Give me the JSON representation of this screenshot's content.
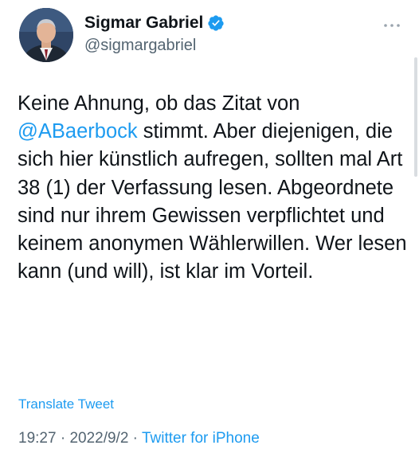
{
  "author": {
    "display_name": "Sigmar Gabriel",
    "handle": "@sigmargabriel",
    "verified": true,
    "avatar_icon": "profile-photo"
  },
  "more_icon": "more-dots-icon",
  "tweet": {
    "text_before": "Keine Ahnung, ob das Zitat von ",
    "mention": "@ABaerbock",
    "text_after": " stimmt. Aber diejenigen, die sich hier künstlich aufregen, sollten mal Art 38 (1) der Verfassung lesen. Abgeordnete sind nur ihrem Gewissen verpflichtet und keinem anonymen Wählerwillen. Wer lesen kann (und will), ist klar im Vorteil."
  },
  "translate_label": "Translate Tweet",
  "meta": {
    "time": "19:27",
    "separator": " · ",
    "date": "2022/9/2",
    "separator2": " · ",
    "source": "Twitter for iPhone"
  },
  "colors": {
    "link": "#1d9bf0",
    "secondary": "#536471",
    "text": "#0f1419"
  }
}
